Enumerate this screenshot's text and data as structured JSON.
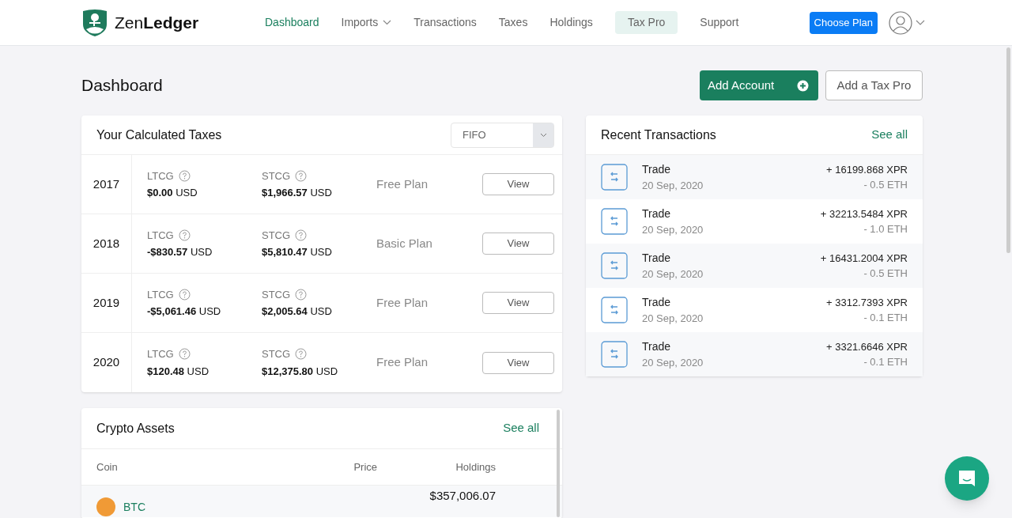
{
  "brand": {
    "name_light": "Zen",
    "name_bold": "Ledger"
  },
  "nav": [
    {
      "label": "Dashboard",
      "selected": true,
      "kind": "link"
    },
    {
      "label": "Imports",
      "selected": false,
      "kind": "dropdown"
    },
    {
      "label": "Transactions",
      "selected": false,
      "kind": "link"
    },
    {
      "label": "Taxes",
      "selected": false,
      "kind": "link"
    },
    {
      "label": "Holdings",
      "selected": false,
      "kind": "link"
    },
    {
      "label": "Tax Pro",
      "selected": false,
      "kind": "highlight"
    },
    {
      "label": "Support",
      "selected": false,
      "kind": "link"
    }
  ],
  "choose_plan": "Choose Plan",
  "page_title": "Dashboard",
  "actions": {
    "add_account": "Add Account",
    "add_tax_pro": "Add a Tax Pro"
  },
  "taxes": {
    "title": "Your Calculated Taxes",
    "method": "FIFO",
    "rows": [
      {
        "year": "2017",
        "ltcg_label": "LTCG",
        "ltcg": "$0.00",
        "ltcg_unit": "USD",
        "stcg_label": "STCG",
        "stcg": "$1,966.57",
        "stcg_unit": "USD",
        "plan": "Free Plan",
        "button": "View"
      },
      {
        "year": "2018",
        "ltcg_label": "LTCG",
        "ltcg": "-$830.57",
        "ltcg_unit": "USD",
        "stcg_label": "STCG",
        "stcg": "$5,810.47",
        "stcg_unit": "USD",
        "plan": "Basic Plan",
        "button": "View"
      },
      {
        "year": "2019",
        "ltcg_label": "LTCG",
        "ltcg": "-$5,061.46",
        "ltcg_unit": "USD",
        "stcg_label": "STCG",
        "stcg": "$2,005.64",
        "stcg_unit": "USD",
        "plan": "Free Plan",
        "button": "View"
      },
      {
        "year": "2020",
        "ltcg_label": "LTCG",
        "ltcg": "$120.48",
        "ltcg_unit": "USD",
        "stcg_label": "STCG",
        "stcg": "$12,375.80",
        "stcg_unit": "USD",
        "plan": "Free Plan",
        "button": "View"
      }
    ]
  },
  "assets": {
    "title": "Crypto Assets",
    "see_all": "See all",
    "columns": [
      "Coin",
      "Price",
      "Holdings"
    ],
    "rows": [
      {
        "coin": "BTC",
        "holdings": "$357,006.07"
      }
    ]
  },
  "recent": {
    "title": "Recent Transactions",
    "see_all": "See all",
    "rows": [
      {
        "type": "Trade",
        "date": "20 Sep, 2020",
        "received": "+ 16199.868 XPR",
        "sent": "- 0.5 ETH"
      },
      {
        "type": "Trade",
        "date": "20 Sep, 2020",
        "received": "+ 32213.5484 XPR",
        "sent": "- 1.0 ETH"
      },
      {
        "type": "Trade",
        "date": "20 Sep, 2020",
        "received": "+ 16431.2004 XPR",
        "sent": "- 0.5 ETH"
      },
      {
        "type": "Trade",
        "date": "20 Sep, 2020",
        "received": "+ 3312.7393 XPR",
        "sent": "- 0.1 ETH"
      },
      {
        "type": "Trade",
        "date": "20 Sep, 2020",
        "received": "+ 3321.6646 XPR",
        "sent": "- 0.1 ETH"
      }
    ]
  }
}
